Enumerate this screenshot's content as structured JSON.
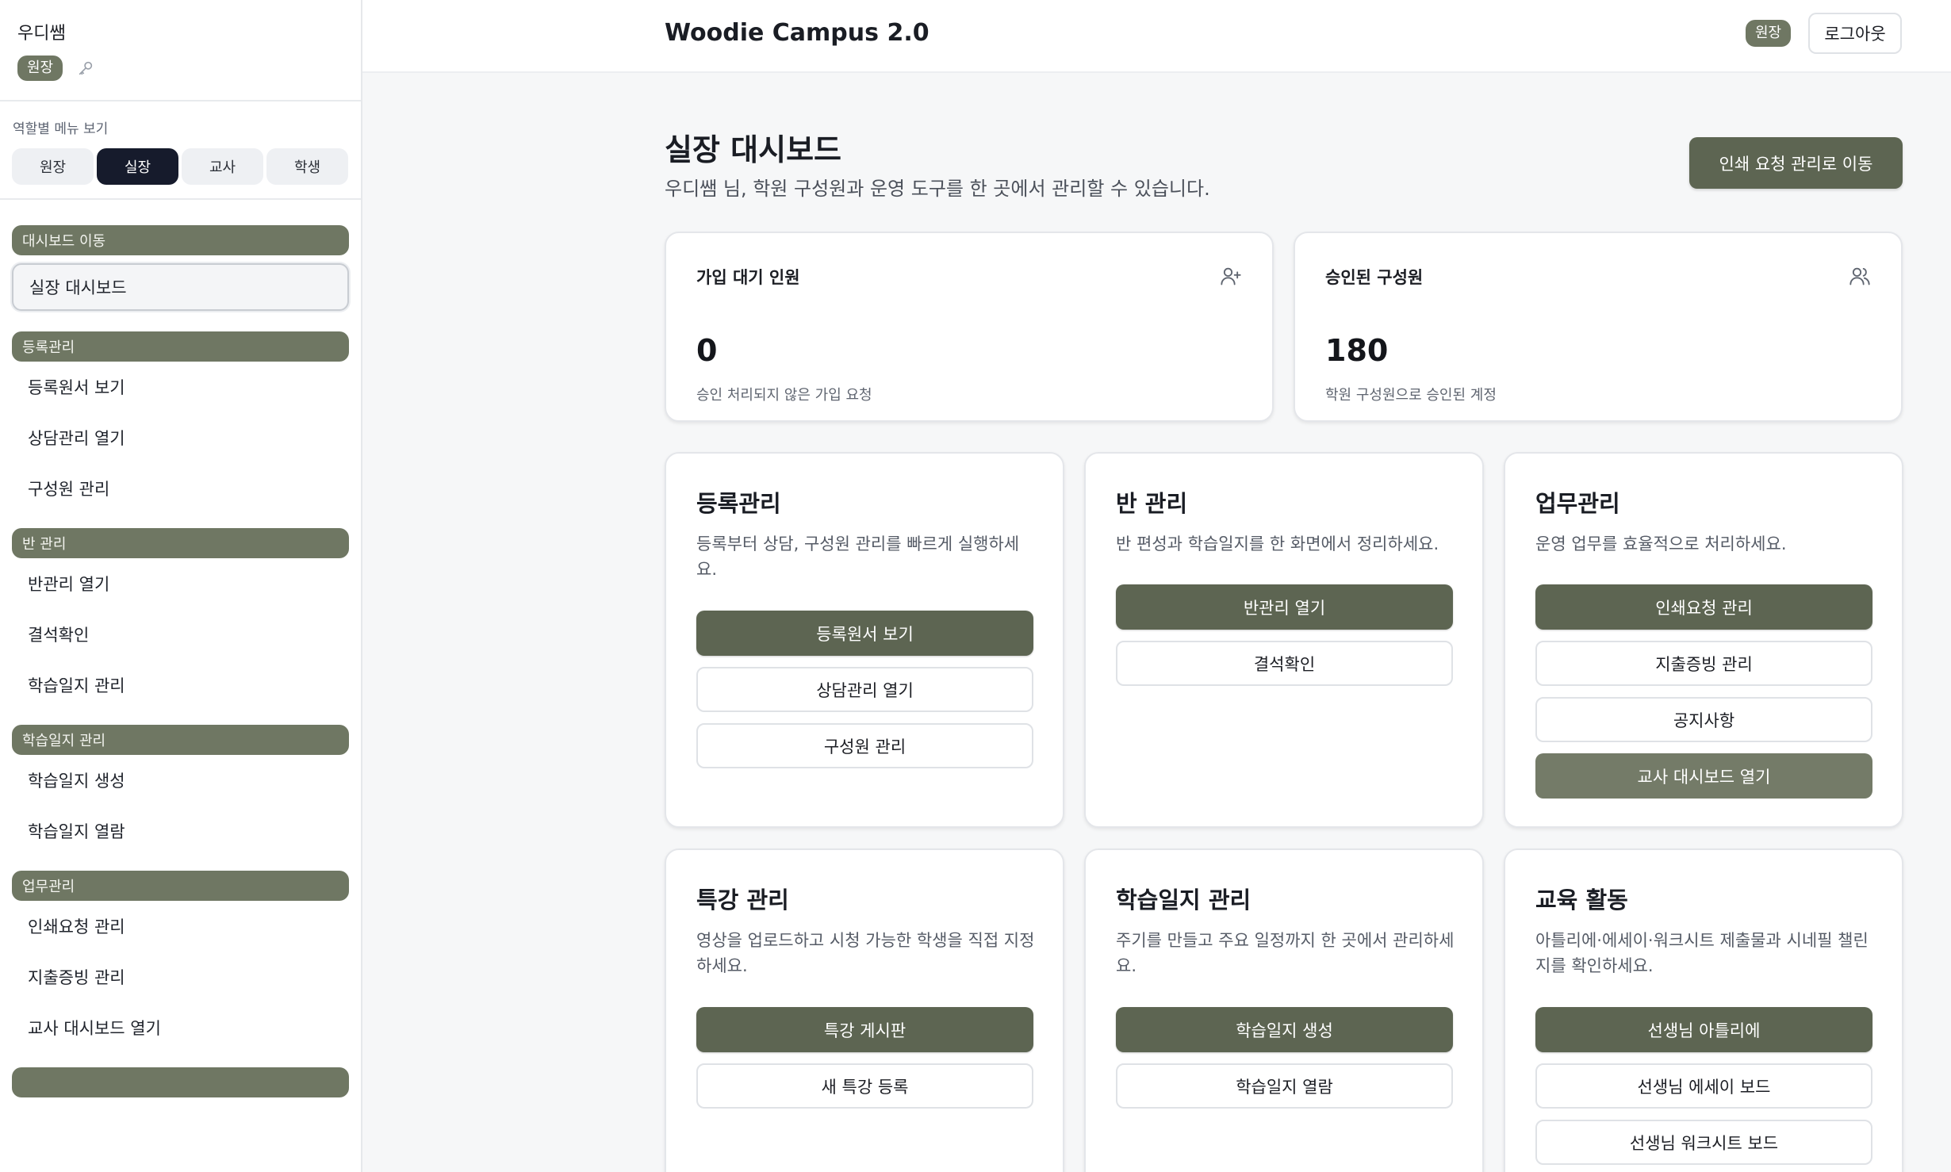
{
  "user": {
    "name": "우디쌤",
    "role_badge": "원장"
  },
  "role_view": {
    "label": "역할별 메뉴 보기",
    "tabs": [
      "원장",
      "실장",
      "교사",
      "학생"
    ],
    "active": "실장"
  },
  "sidebar": {
    "sections": [
      {
        "header": "대시보드 이동",
        "items": [
          "실장 대시보드"
        ]
      },
      {
        "header": "등록관리",
        "items": [
          "등록원서 보기",
          "상담관리 열기",
          "구성원 관리"
        ]
      },
      {
        "header": "반 관리",
        "items": [
          "반관리 열기",
          "결석확인",
          "학습일지 관리"
        ]
      },
      {
        "header": "학습일지 관리",
        "items": [
          "학습일지 생성",
          "학습일지 열람"
        ]
      },
      {
        "header": "업무관리",
        "items": [
          "인쇄요청 관리",
          "지출증빙 관리",
          "교사 대시보드 열기"
        ]
      }
    ]
  },
  "topbar": {
    "title": "Woodie Campus 2.0",
    "badge": "원장",
    "logout": "로그아웃"
  },
  "main": {
    "title": "실장 대시보드",
    "subtitle": "우디쌤 님, 학원 구성원과 운영 도구를 한 곳에서 관리할 수 있습니다.",
    "print_button": "인쇄 요청 관리로 이동",
    "stats": [
      {
        "label": "가입 대기 인원",
        "value": "0",
        "note": "승인 처리되지 않은 가입 요청",
        "icon": "user-plus-icon"
      },
      {
        "label": "승인된 구성원",
        "value": "180",
        "note": "학원 구성원으로 승인된 계정",
        "icon": "users-icon"
      }
    ],
    "cards": [
      {
        "title": "등록관리",
        "desc": "등록부터 상담, 구성원 관리를 빠르게 실행하세요.",
        "buttons": [
          "등록원서 보기",
          "상담관리 열기",
          "구성원 관리"
        ]
      },
      {
        "title": "반 관리",
        "desc": "반 편성과 학습일지를 한 화면에서 정리하세요.",
        "buttons": [
          "반관리 열기",
          "결석확인"
        ]
      },
      {
        "title": "업무관리",
        "desc": "운영 업무를 효율적으로 처리하세요.",
        "buttons": [
          "인쇄요청 관리",
          "지출증빙 관리",
          "공지사항",
          "교사 대시보드 열기"
        ]
      },
      {
        "title": "특강 관리",
        "desc": "영상을 업로드하고 시청 가능한 학생을 직접 지정하세요.",
        "buttons": [
          "특강 게시판",
          "새 특강 등록"
        ]
      },
      {
        "title": "학습일지 관리",
        "desc": "주기를 만들고 주요 일정까지 한 곳에서 관리하세요.",
        "buttons": [
          "학습일지 생성",
          "학습일지 열람"
        ]
      },
      {
        "title": "교육 활동",
        "desc": "아틀리에·에세이·워크시트 제출물과 시네필 챌린지를 확인하세요.",
        "buttons": [
          "선생님 아틀리에",
          "선생님 에세이 보드",
          "선생님 워크시트 보드"
        ]
      }
    ]
  },
  "colors": {
    "accent": "#5d6552",
    "section_header": "#6f7763",
    "active_tab": "#161b2c"
  }
}
